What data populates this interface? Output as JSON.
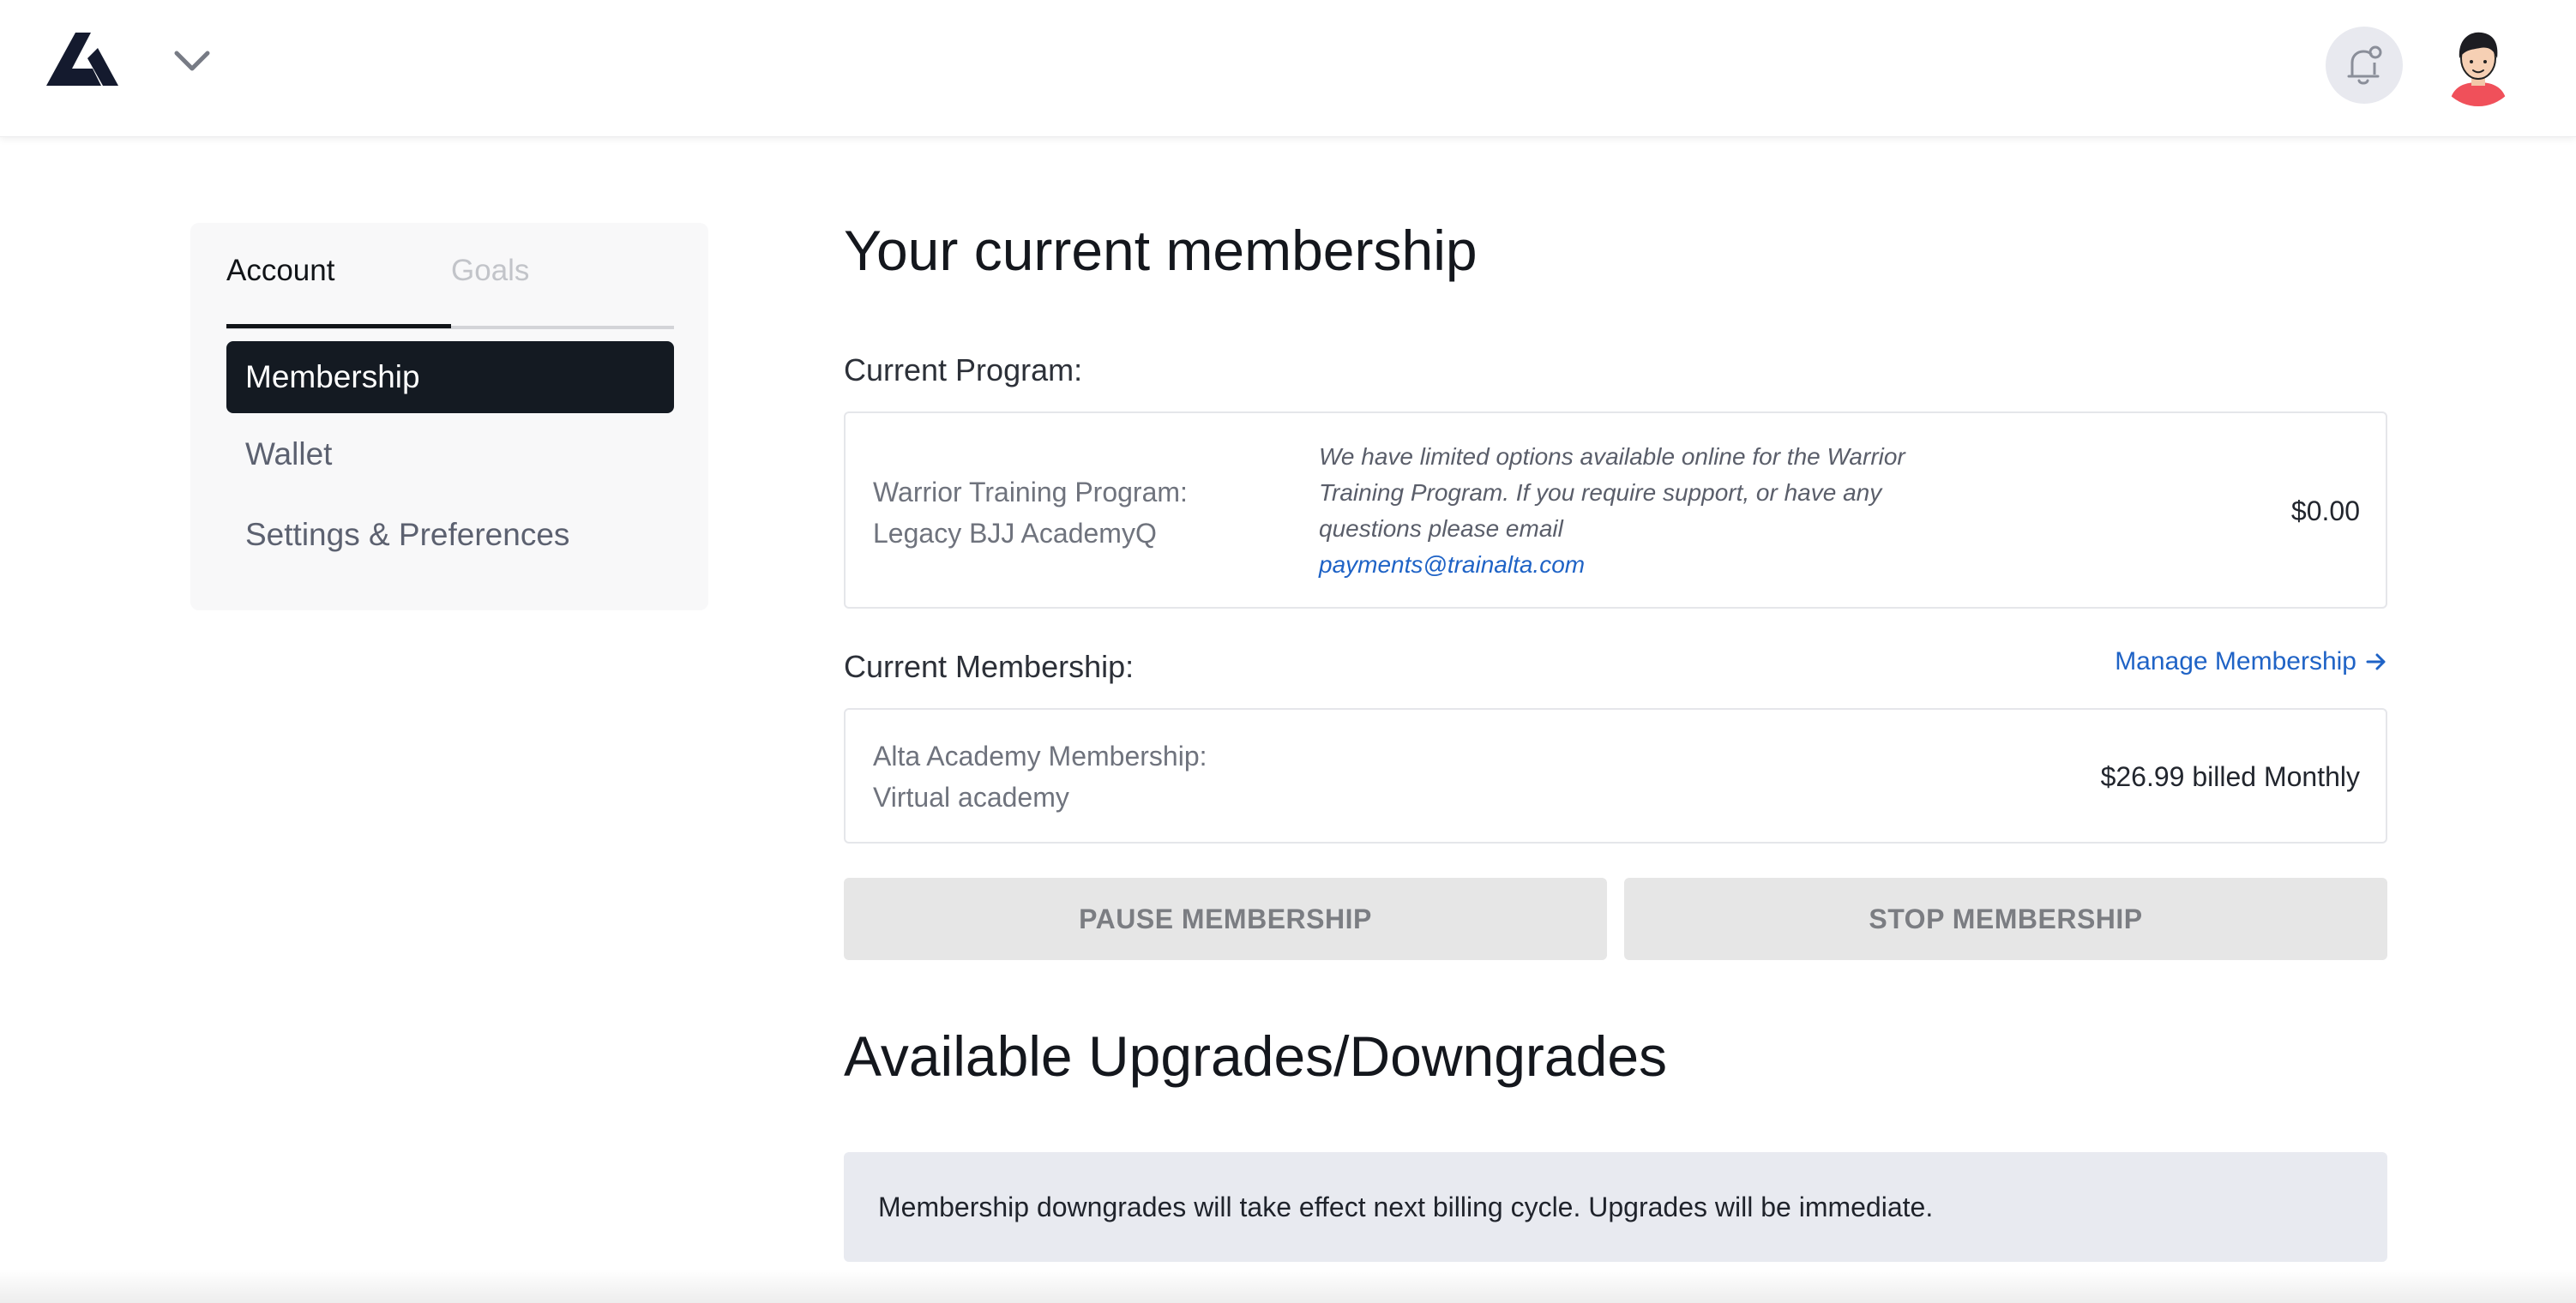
{
  "header": {
    "logo_icon": "alta-logo",
    "menu_icon": "chevron-down-icon",
    "notifications_icon": "bell-icon",
    "avatar_icon": "user-avatar"
  },
  "sidebar": {
    "tabs": [
      {
        "label": "Account",
        "active": true
      },
      {
        "label": "Goals",
        "active": false
      }
    ],
    "items": [
      {
        "label": "Membership",
        "active": true
      },
      {
        "label": "Wallet",
        "active": false
      },
      {
        "label": "Settings & Preferences",
        "active": false
      }
    ]
  },
  "main": {
    "title": "Your current membership",
    "current_program": {
      "label": "Current Program:",
      "name_line1": "Warrior Training Program:",
      "name_line2": "Legacy BJJ AcademyQ",
      "note": "We have limited options available online for the Warrior Training Program. If you require support, or have any questions please email",
      "email": "payments@trainalta.com",
      "price": "$0.00"
    },
    "current_membership": {
      "label": "Current Membership:",
      "manage_link": "Manage Membership",
      "name_line1": "Alta Academy Membership:",
      "name_line2": "Virtual academy",
      "price": "$26.99 billed Monthly"
    },
    "buttons": {
      "pause": "PAUSE MEMBERSHIP",
      "stop": "STOP MEMBERSHIP"
    },
    "upgrades": {
      "title": "Available Upgrades/Downgrades",
      "notice": "Membership downgrades will take effect next billing cycle. Upgrades will be immediate."
    }
  },
  "colors": {
    "accent": "#1f63c6",
    "active_nav_bg": "#141a22",
    "button_bg": "#e6e6e6",
    "notice_bg": "#e8eaf0"
  }
}
